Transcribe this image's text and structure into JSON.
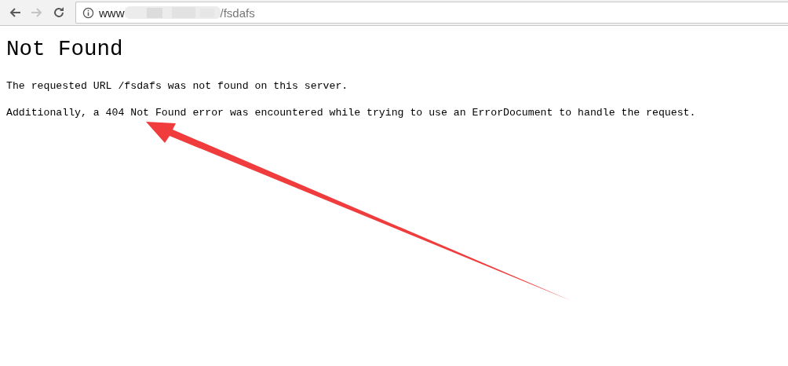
{
  "toolbar": {
    "buttons": [
      {
        "kind": "back",
        "disabled": false
      },
      {
        "kind": "forward",
        "disabled": true
      },
      {
        "kind": "reload",
        "disabled": false
      }
    ],
    "address": {
      "prefix": "www",
      "suffix": "/fsdafs"
    }
  },
  "page": {
    "heading": "Not Found",
    "paragraphs": [
      "The requested URL /fsdafs was not found on this server.",
      "Additionally, a 404 Not Found error was encountered while trying to use an ErrorDocument to handle the request."
    ]
  }
}
